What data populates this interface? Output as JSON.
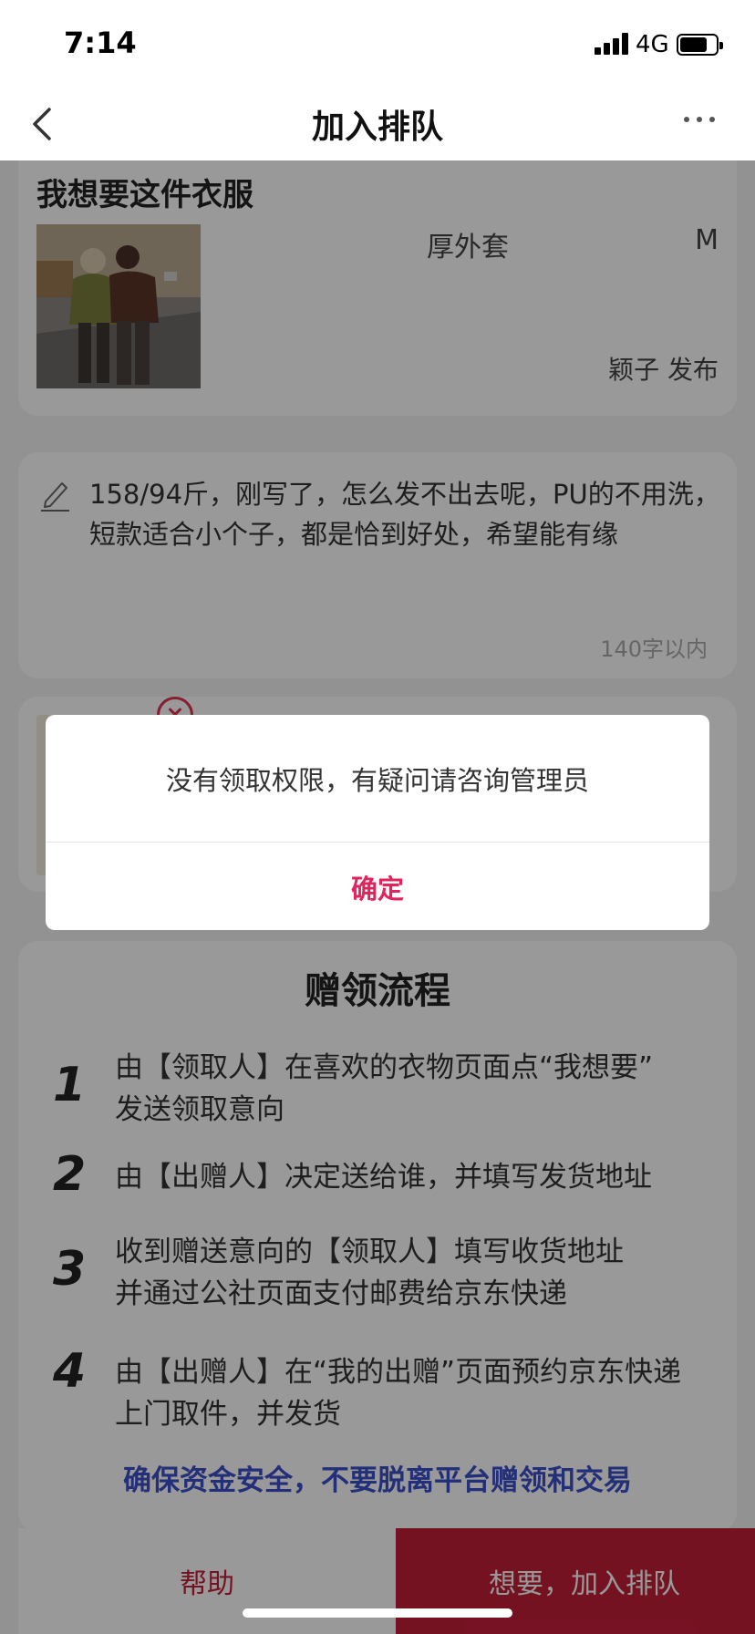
{
  "status_bar": {
    "time": "7:14",
    "network": "4G"
  },
  "nav": {
    "title": "加入排队",
    "back_icon": "chevron-left-icon",
    "more_icon": "more-dots-icon"
  },
  "item": {
    "title": "我想要这件衣服",
    "category": "厚外套",
    "size": "M",
    "publisher": "颖子 发布"
  },
  "message": {
    "text": "158/94斤，刚写了，怎么发不出去呢，PU的不用洗，短款适合小个子，都是恰到好处，希望能有缘",
    "counter": "140字以内",
    "icon": "pencil-icon"
  },
  "flow": {
    "title": "赠领流程",
    "steps": [
      {
        "num": "1",
        "text": "由【领取人】在喜欢的衣物页面点“我想要”\n发送领取意向"
      },
      {
        "num": "2",
        "text": "由【出赠人】决定送给谁，并填写发货地址"
      },
      {
        "num": "3",
        "text": "收到赠送意向的【领取人】填写收货地址\n并通过公社页面支付邮费给京东快递"
      },
      {
        "num": "4",
        "text": "由【出赠人】在“我的出赠”页面预约京东快递\n上门取件，并发货"
      }
    ],
    "warning": "确保资金安全，不要脱离平台赠领和交易"
  },
  "bottom": {
    "help_label": "帮助",
    "join_label": "想要，加入排队"
  },
  "dialog": {
    "message": "没有领取权限，有疑问请咨询管理员",
    "confirm_label": "确定"
  },
  "colors": {
    "accent": "#c41e3a",
    "confirm": "#e0245e",
    "warning": "#3b4fc8"
  }
}
